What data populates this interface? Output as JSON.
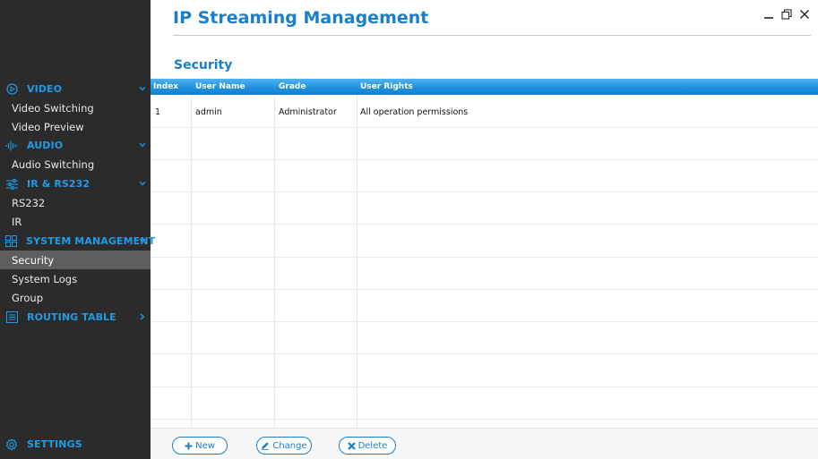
{
  "app": {
    "title": "IP Streaming Management"
  },
  "window_controls": {
    "minimize": "minimize-icon",
    "maximize": "maximize-icon",
    "close": "close-icon"
  },
  "sidebar": {
    "sections": [
      {
        "label": "VIDEO",
        "icon": "play-circle-icon",
        "items": [
          "Video Switching",
          "Video Preview"
        ]
      },
      {
        "label": "AUDIO",
        "icon": "audio-wave-icon",
        "items": [
          "Audio Switching"
        ]
      },
      {
        "label": "IR & RS232",
        "icon": "sliders-icon",
        "items": [
          "RS232",
          "IR"
        ]
      },
      {
        "label": "SYSTEM MANAGEMENT",
        "icon": "grid-icon",
        "items": [
          "Security",
          "System Logs",
          "Group"
        ]
      },
      {
        "label": "ROUTING TABLE",
        "icon": "list-icon",
        "items": []
      }
    ],
    "active_item": "Security",
    "settings": {
      "label": "SETTINGS",
      "icon": "gear-icon"
    }
  },
  "page": {
    "section_title": "Security"
  },
  "table": {
    "columns": [
      "Index",
      "User Name",
      "Grade",
      "User Rights"
    ],
    "rows": [
      [
        "1",
        "admin",
        "Administrator",
        "All operation permissions"
      ]
    ]
  },
  "footer": {
    "new_label": "New",
    "change_label": "Change",
    "delete_label": "Delete"
  },
  "colors": {
    "accent": "#1b7ec9",
    "sidebar_bg": "#2b2b2b",
    "sidebar_header": "#1e9ce8",
    "active_item_bg": "#5e5e5e",
    "table_header": "#1e8fdd"
  }
}
